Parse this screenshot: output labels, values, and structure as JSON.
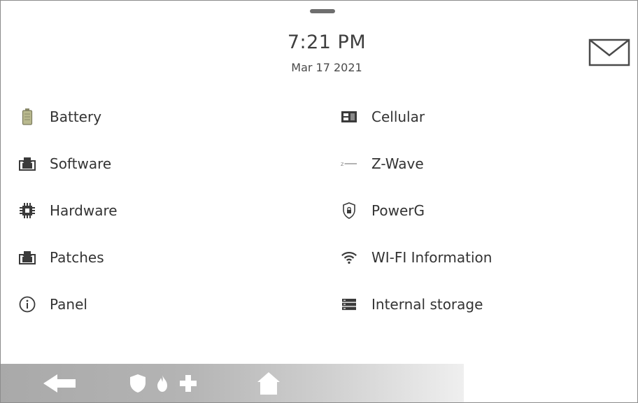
{
  "header": {
    "time": "7:21 PM",
    "date": "Mar 17 2021"
  },
  "icons": {
    "messages": "envelope-icon"
  },
  "menu": {
    "left": [
      {
        "label": "Battery",
        "icon": "battery-icon"
      },
      {
        "label": "Software",
        "icon": "software-download-icon"
      },
      {
        "label": "Hardware",
        "icon": "chip-icon"
      },
      {
        "label": "Patches",
        "icon": "patch-download-icon"
      },
      {
        "label": "Panel",
        "icon": "info-icon"
      }
    ],
    "right": [
      {
        "label": "Cellular",
        "icon": "cellular-icon"
      },
      {
        "label": "Z-Wave",
        "icon": "z-wave-icon"
      },
      {
        "label": "PowerG",
        "icon": "powerg-shield-icon"
      },
      {
        "label": "WI-FI Information",
        "icon": "wifi-icon"
      },
      {
        "label": "Internal storage",
        "icon": "storage-icon"
      }
    ]
  },
  "navbar": {
    "buttons": [
      "back-arrow-icon",
      "security-shield-icon",
      "emergency-fire-icon",
      "medical-cross-icon",
      "home-icon"
    ]
  },
  "colors": {
    "text": "#333333",
    "icon": "#3a3a3a",
    "navbar": "#b0b0b0",
    "nav_icon": "#ffffff"
  }
}
